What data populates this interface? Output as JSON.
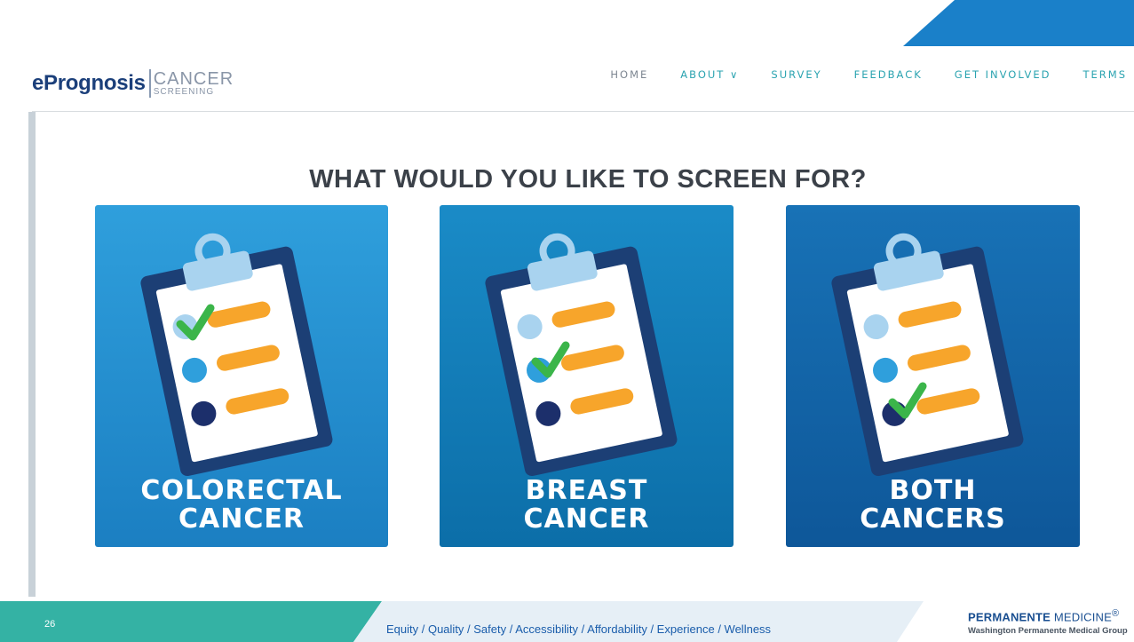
{
  "logo": {
    "main": "ePrognosis",
    "sub_top": "CANCER",
    "sub_bottom": "SCREENING"
  },
  "nav": [
    {
      "label": "HOME"
    },
    {
      "label": "ABOUT ∨"
    },
    {
      "label": "SURVEY"
    },
    {
      "label": "FEEDBACK"
    },
    {
      "label": "GET INVOLVED"
    },
    {
      "label": "TERMS"
    }
  ],
  "headline": "WHAT WOULD YOU LIKE TO SCREEN FOR?",
  "cards": [
    {
      "line1": "COLORECTAL",
      "line2": "CANCER",
      "checked_item": 1
    },
    {
      "line1": "BREAST",
      "line2": "CANCER",
      "checked_item": 2
    },
    {
      "line1": "BOTH",
      "line2": "CANCERS",
      "checked_item": 3
    }
  ],
  "footer": {
    "slide_number": "26",
    "tagline": "Equity / Quality / Safety / Accessibility / Affordability / Experience / Wellness",
    "brand_bold": "PERMANENTE",
    "brand_light": "MEDICINE",
    "brand_mark": "®",
    "brand_group": "Washington Permanente Medical Group"
  },
  "colors": {
    "navy": "#1b3f7a",
    "accent_teal": "#2aa3b0",
    "check_green": "#3bb54a",
    "bar_orange": "#f7a52b",
    "corner_blue": "#1a80c9"
  }
}
